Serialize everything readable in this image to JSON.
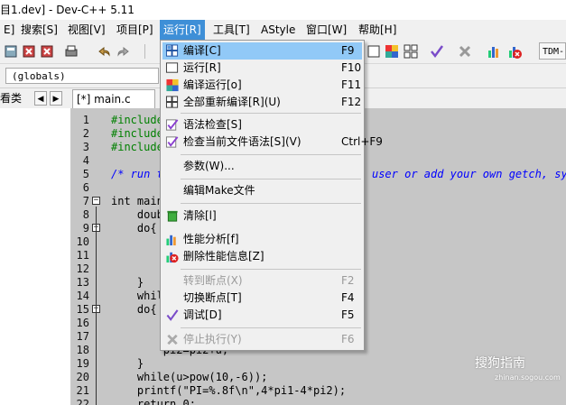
{
  "window": {
    "title": "目1.dev] - Dev-C++ 5.11"
  },
  "menubar": {
    "items": [
      "E]",
      "搜索[S]",
      "视图[V]",
      "项目[P]",
      "运行[R]",
      "工具[T]",
      "AStyle",
      "窗口[W]",
      "帮助[H]"
    ],
    "active_index": 4
  },
  "toolbar": {
    "compiler_label": "TDM-"
  },
  "scope": {
    "value": "(globals)"
  },
  "tabs": {
    "left_label": "看类",
    "file_tab": "[*] main.c"
  },
  "editor": {
    "lines": [
      {
        "n": "1",
        "text": "#include"
      },
      {
        "n": "2",
        "text": "#include"
      },
      {
        "n": "3",
        "text": "#include"
      },
      {
        "n": "4",
        "text": ""
      },
      {
        "n": "5",
        "text": "/* run t                                user or add your own getch, syst"
      },
      {
        "n": "6",
        "text": ""
      },
      {
        "n": "7",
        "text": "int main"
      },
      {
        "n": "8",
        "text": "    doub"
      },
      {
        "n": "9",
        "text": "    do{"
      },
      {
        "n": "10",
        "text": ""
      },
      {
        "n": "11",
        "text": ""
      },
      {
        "n": "12",
        "text": ""
      },
      {
        "n": "13",
        "text": "    }"
      },
      {
        "n": "14",
        "text": "    whil"
      },
      {
        "n": "15",
        "text": "    do{"
      },
      {
        "n": "16",
        "text": ""
      },
      {
        "n": "17",
        "text": ""
      },
      {
        "n": "18",
        "text": "        pi2=pi2+u;"
      },
      {
        "n": "19",
        "text": "    }"
      },
      {
        "n": "20",
        "text": "    while(u>pow(10,-6));"
      },
      {
        "n": "21",
        "text": "    printf(\"PI=%.8f\\n\",4*pi1-4*pi2);"
      },
      {
        "n": "22",
        "text": "    return 0;"
      }
    ]
  },
  "run_menu": {
    "items": [
      {
        "label": "编译[C]",
        "shortcut": "F9",
        "icon": "compile-icon",
        "highlight": true,
        "disabled": false
      },
      {
        "label": "运行[R]",
        "shortcut": "F10",
        "icon": "run-icon",
        "highlight": false,
        "disabled": false
      },
      {
        "label": "编译运行[o]",
        "shortcut": "F11",
        "icon": "compile-run-icon",
        "highlight": false,
        "disabled": false
      },
      {
        "label": "全部重新编译[R](U)",
        "shortcut": "F12",
        "icon": "rebuild-all-icon",
        "highlight": false,
        "disabled": false
      },
      {
        "label": "语法检查[S]",
        "shortcut": "",
        "icon": "syntax-check-icon",
        "highlight": false,
        "disabled": false
      },
      {
        "label": "检查当前文件语法[S](V)",
        "shortcut": "Ctrl+F9",
        "icon": "syntax-check-file-icon",
        "highlight": false,
        "disabled": false
      },
      {
        "label": "参数(W)...",
        "shortcut": "",
        "icon": "",
        "highlight": false,
        "disabled": false
      },
      {
        "label": "编辑Make文件",
        "shortcut": "",
        "icon": "",
        "highlight": false,
        "disabled": false
      },
      {
        "label": "清除[l]",
        "shortcut": "",
        "icon": "clean-icon",
        "highlight": false,
        "disabled": false
      },
      {
        "label": "性能分析[f]",
        "shortcut": "",
        "icon": "profile-icon",
        "highlight": false,
        "disabled": false
      },
      {
        "label": "删除性能信息[Z]",
        "shortcut": "",
        "icon": "delete-profile-icon",
        "highlight": false,
        "disabled": false
      },
      {
        "label": "转到断点(X)",
        "shortcut": "F2",
        "icon": "",
        "highlight": false,
        "disabled": true
      },
      {
        "label": "切换断点[T]",
        "shortcut": "F4",
        "icon": "",
        "highlight": false,
        "disabled": false
      },
      {
        "label": "调试[D]",
        "shortcut": "F5",
        "icon": "debug-icon",
        "highlight": false,
        "disabled": false
      },
      {
        "label": "停止执行(Y)",
        "shortcut": "F6",
        "icon": "stop-icon",
        "highlight": false,
        "disabled": true
      }
    ]
  },
  "watermark": {
    "brand": "搜狗指南",
    "url": "zhinan.sogou.com"
  },
  "colors": {
    "menu_active": "#3e8fd7",
    "menu_highlight": "#91c9f7",
    "editor_bg": "#c6c6c6"
  }
}
